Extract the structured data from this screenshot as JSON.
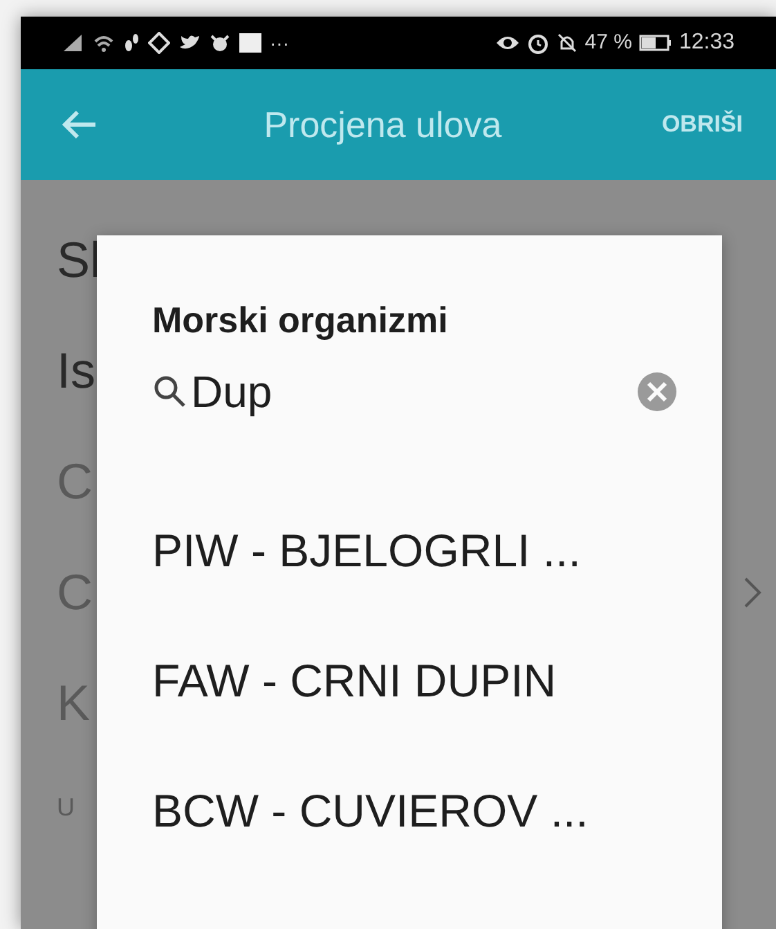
{
  "status_bar": {
    "overflow": "···",
    "battery": "47 %",
    "time": "12:33"
  },
  "app_bar": {
    "title": "Procjena ulova",
    "action": "OBRIŠI"
  },
  "background_rows": [
    {
      "text": "Sl",
      "kind": "label",
      "chevron": false
    },
    {
      "text": "Is",
      "kind": "label",
      "chevron": false
    },
    {
      "text": "C",
      "kind": "hint",
      "chevron": false
    },
    {
      "text": "C",
      "kind": "hint",
      "chevron": true
    },
    {
      "text": "K",
      "kind": "hint",
      "chevron": false
    },
    {
      "text": "U",
      "kind": "small",
      "chevron": false
    }
  ],
  "dialog": {
    "title": "Morski organizmi",
    "search": {
      "value": "Dup"
    },
    "items": [
      {
        "label": "PIW - BJELOGRLI ..."
      },
      {
        "label": "FAW - CRNI DUPIN"
      },
      {
        "label": "BCW - CUVIEROV ..."
      }
    ]
  }
}
